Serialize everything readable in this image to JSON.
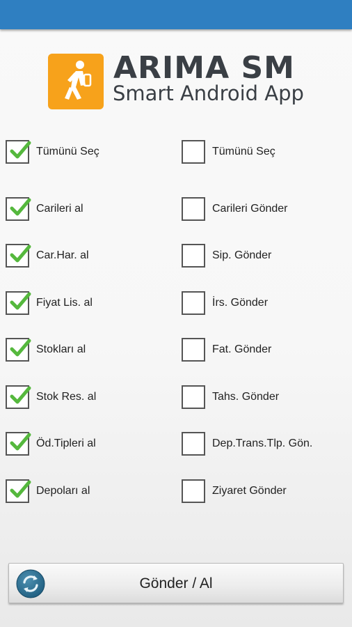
{
  "header": {
    "app_title": "ARIMA SM",
    "app_subtitle": "Smart Android App",
    "logo_icon": "walking-person-icon"
  },
  "colors": {
    "top_bar": "#2f7fc1",
    "logo_background": "#f7a21b",
    "check": "#55b83d"
  },
  "left_options": [
    {
      "label": "Tümünü Seç",
      "checked": true
    },
    {
      "label": "Carileri al",
      "checked": true
    },
    {
      "label": "Car.Har. al",
      "checked": true
    },
    {
      "label": "Fiyat Lis. al",
      "checked": true
    },
    {
      "label": "Stokları al",
      "checked": true
    },
    {
      "label": "Stok Res. al",
      "checked": true
    },
    {
      "label": "Öd.Tipleri al",
      "checked": true
    },
    {
      "label": "Depoları al",
      "checked": true
    }
  ],
  "right_options": [
    {
      "label": "Tümünü Seç",
      "checked": false
    },
    {
      "label": "Carileri Gönder",
      "checked": false
    },
    {
      "label": "Sip. Gönder",
      "checked": false
    },
    {
      "label": "İrs. Gönder",
      "checked": false
    },
    {
      "label": "Fat. Gönder",
      "checked": false
    },
    {
      "label": "Tahs. Gönder",
      "checked": false
    },
    {
      "label": "Dep.Trans.Tlp. Gön.",
      "checked": false
    },
    {
      "label": "Ziyaret Gönder",
      "checked": false
    }
  ],
  "action_button": {
    "label": "Gönder / Al",
    "icon": "sync-icon"
  }
}
